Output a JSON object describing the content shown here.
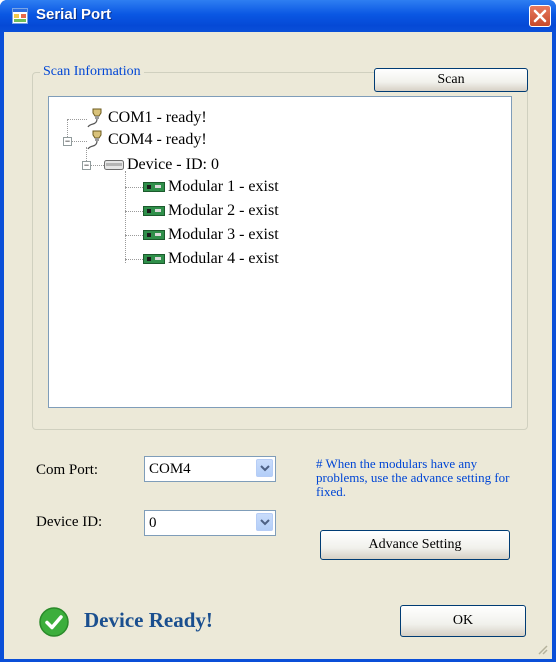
{
  "window": {
    "title": "Serial Port"
  },
  "scan": {
    "group_label": "Scan Information",
    "scan_button": "Scan",
    "tree": {
      "com1": "COM1 - ready!",
      "com4": "COM4 - ready!",
      "device": "Device - ID: 0",
      "modulars": [
        "Modular 1 - exist",
        "Modular 2 - exist",
        "Modular 3 - exist",
        "Modular 4 - exist"
      ]
    }
  },
  "form": {
    "com_port_label": "Com Port:",
    "com_port_value": "COM4",
    "device_id_label": "Device ID:",
    "device_id_value": "0",
    "note": "# When the modulars have any problems, use the advance setting for fixed.",
    "advance_button": "Advance Setting"
  },
  "status": {
    "text": "Device Ready!",
    "icon": "check-circle-icon",
    "color": "#1a4f8f"
  },
  "footer": {
    "ok_button": "OK"
  },
  "colors": {
    "title_bar": "#0a57e3",
    "client_bg": "#ece9d8",
    "link_blue": "#0046d5",
    "close": "#c64a2b"
  }
}
